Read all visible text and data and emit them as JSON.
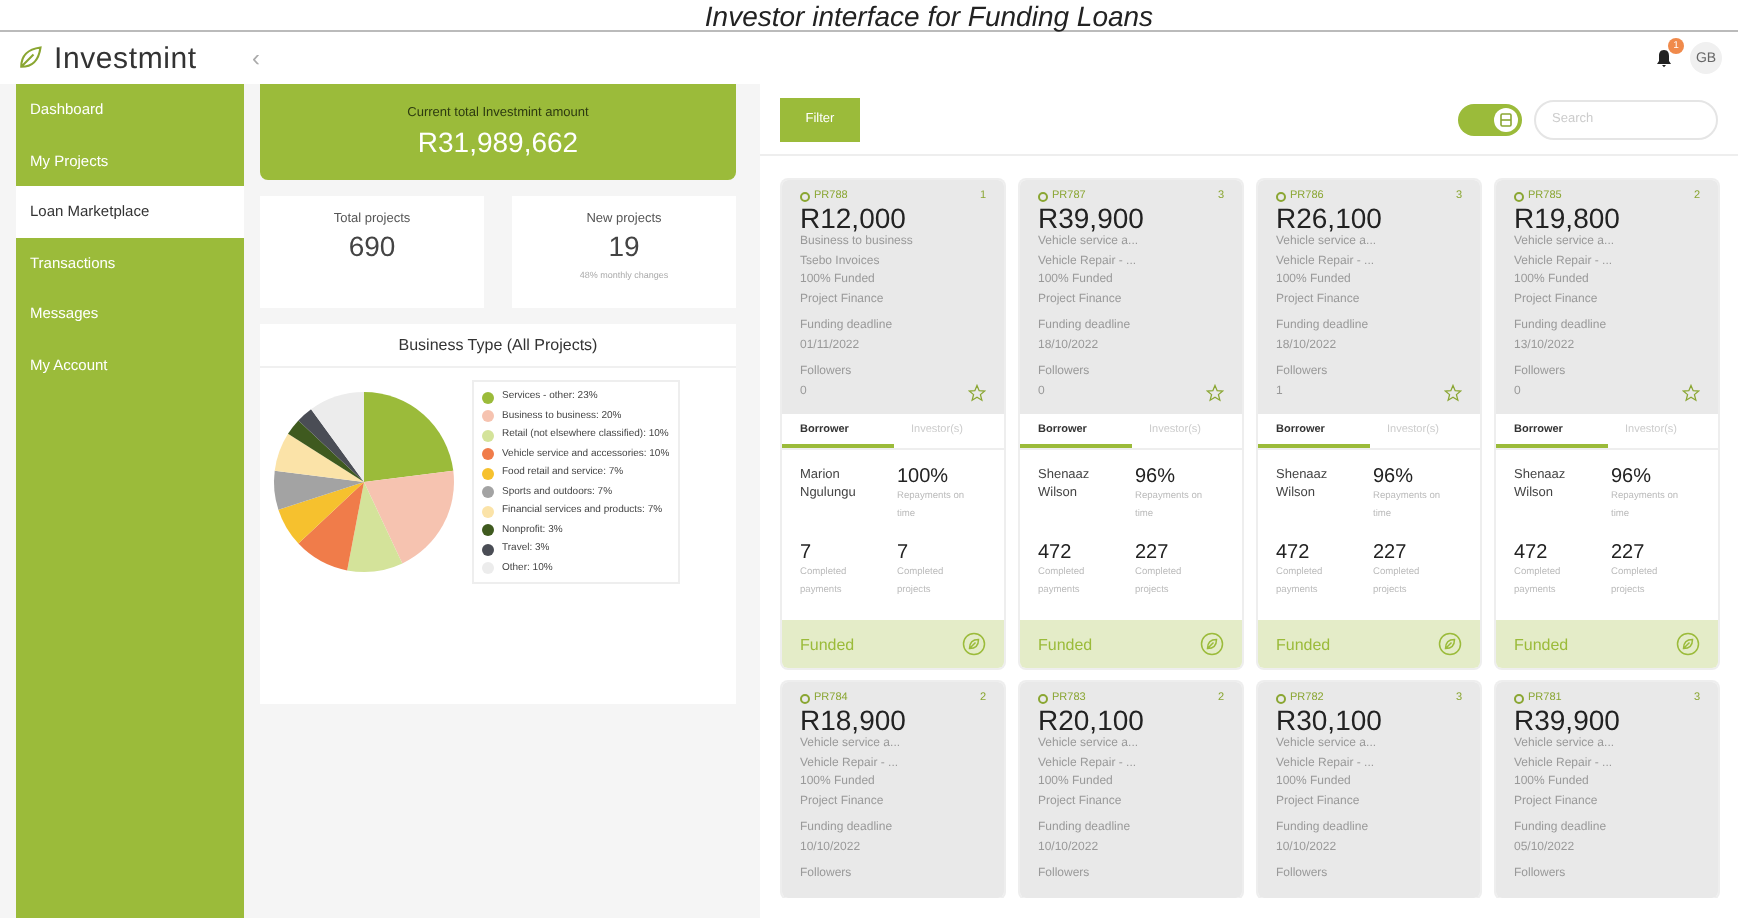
{
  "caption": "Investor interface for Funding Loans",
  "header": {
    "logo": "Investmint",
    "collapse": "‹",
    "notifications": "1",
    "user_initials": "GB"
  },
  "sidebar": {
    "items": [
      {
        "label": "Dashboard",
        "selected": false
      },
      {
        "label": "My Projects",
        "selected": false
      },
      {
        "label": "Loan Marketplace",
        "selected": true
      },
      {
        "label": "Transactions",
        "selected": false
      },
      {
        "label": "Messages",
        "selected": false
      },
      {
        "label": "My Account",
        "selected": false
      }
    ]
  },
  "summary": {
    "total_label": "Current total Investmint amount",
    "total_amount": "R31,989,662",
    "stats": [
      {
        "label": "Total projects",
        "value": "690"
      },
      {
        "label": "New projects",
        "value": "19",
        "note": "48% monthly changes"
      }
    ]
  },
  "business_chart": {
    "chart_data": {
      "type": "pie",
      "title": "Business Type (All Projects)",
      "categories": [
        "Services - other: 23%",
        "Business to business: 20%",
        "Retail (not elsewhere classified): 10%",
        "Vehicle service and accessories: 10%",
        "Food retail and service: 7%",
        "Sports and outdoors: 7%",
        "Financial services and products: 7%",
        "Nonprofit: 3%",
        "Travel: 3%",
        "Other: 10%"
      ],
      "values": [
        23,
        20,
        10,
        10,
        7,
        7,
        7,
        3,
        3,
        10
      ],
      "colors": [
        "#9bbb3a",
        "#f6c3b0",
        "#d4e39a",
        "#f07c4a",
        "#f6c12e",
        "#a3a3a3",
        "#fbe3a8",
        "#3f5a1f",
        "#4a4d55",
        "#ececec"
      ]
    }
  },
  "toolbar": {
    "filter": "Filter",
    "view_toggle": {
      "on": true
    },
    "search": {
      "placeholder": "Search"
    }
  },
  "cards": [
    {
      "id": "PR788",
      "count": "1",
      "amount": "R12,000",
      "lines": [
        "Business to business",
        "Tsebo Invoices",
        "100% Funded",
        "Project Finance"
      ],
      "deadline_label": "Funding deadline",
      "deadline": "01/11/2022",
      "followers_label": "Followers",
      "followers": "0",
      "tabs": [
        {
          "label": "Borrower",
          "selected": true
        },
        {
          "label": "Investor(s)",
          "selected": false
        }
      ],
      "borrower": "Marion Ngulungu",
      "stats": [
        {
          "value": "100%",
          "label": "Repayments on time"
        },
        {
          "value": "7",
          "label": "Completed payments"
        },
        {
          "value": "7",
          "label": "Completed projects"
        }
      ],
      "status": "Funded"
    },
    {
      "id": "PR787",
      "count": "3",
      "amount": "R39,900",
      "lines": [
        "Vehicle service a...",
        "Vehicle Repair - ...",
        "100% Funded",
        "Project Finance"
      ],
      "deadline_label": "Funding deadline",
      "deadline": "18/10/2022",
      "followers_label": "Followers",
      "followers": "0",
      "tabs": [
        {
          "label": "Borrower",
          "selected": true
        },
        {
          "label": "Investor(s)",
          "selected": false
        }
      ],
      "borrower": "Shenaaz Wilson",
      "stats": [
        {
          "value": "96%",
          "label": "Repayments on time"
        },
        {
          "value": "472",
          "label": "Completed payments"
        },
        {
          "value": "227",
          "label": "Completed projects"
        }
      ],
      "status": "Funded"
    },
    {
      "id": "PR786",
      "count": "3",
      "amount": "R26,100",
      "lines": [
        "Vehicle service a...",
        "Vehicle Repair - ...",
        "100% Funded",
        "Project Finance"
      ],
      "deadline_label": "Funding deadline",
      "deadline": "18/10/2022",
      "followers_label": "Followers",
      "followers": "1",
      "tabs": [
        {
          "label": "Borrower",
          "selected": true
        },
        {
          "label": "Investor(s)",
          "selected": false
        }
      ],
      "borrower": "Shenaaz Wilson",
      "stats": [
        {
          "value": "96%",
          "label": "Repayments on time"
        },
        {
          "value": "472",
          "label": "Completed payments"
        },
        {
          "value": "227",
          "label": "Completed projects"
        }
      ],
      "status": "Funded"
    },
    {
      "id": "PR785",
      "count": "2",
      "amount": "R19,800",
      "lines": [
        "Vehicle service a...",
        "Vehicle Repair - ...",
        "100% Funded",
        "Project Finance"
      ],
      "deadline_label": "Funding deadline",
      "deadline": "13/10/2022",
      "followers_label": "Followers",
      "followers": "0",
      "tabs": [
        {
          "label": "Borrower",
          "selected": true
        },
        {
          "label": "Investor(s)",
          "selected": false
        }
      ],
      "borrower": "Shenaaz Wilson",
      "stats": [
        {
          "value": "96%",
          "label": "Repayments on time"
        },
        {
          "value": "472",
          "label": "Completed payments"
        },
        {
          "value": "227",
          "label": "Completed projects"
        }
      ],
      "status": "Funded"
    },
    {
      "id": "PR784",
      "count": "2",
      "amount": "R18,900",
      "lines": [
        "Vehicle service a...",
        "Vehicle Repair - ...",
        "100% Funded",
        "Project Finance"
      ],
      "deadline_label": "Funding deadline",
      "deadline": "10/10/2022",
      "followers_label": "Followers"
    },
    {
      "id": "PR783",
      "count": "2",
      "amount": "R20,100",
      "lines": [
        "Vehicle service a...",
        "Vehicle Repair - ...",
        "100% Funded",
        "Project Finance"
      ],
      "deadline_label": "Funding deadline",
      "deadline": "10/10/2022",
      "followers_label": "Followers"
    },
    {
      "id": "PR782",
      "count": "3",
      "amount": "R30,100",
      "lines": [
        "Vehicle service a...",
        "Vehicle Repair - ...",
        "100% Funded",
        "Project Finance"
      ],
      "deadline_label": "Funding deadline",
      "deadline": "10/10/2022",
      "followers_label": "Followers"
    },
    {
      "id": "PR781",
      "count": "3",
      "amount": "R39,900",
      "lines": [
        "Vehicle service a...",
        "Vehicle Repair - ...",
        "100% Funded",
        "Project Finance"
      ],
      "deadline_label": "Funding deadline",
      "deadline": "05/10/2022",
      "followers_label": "Followers"
    }
  ]
}
